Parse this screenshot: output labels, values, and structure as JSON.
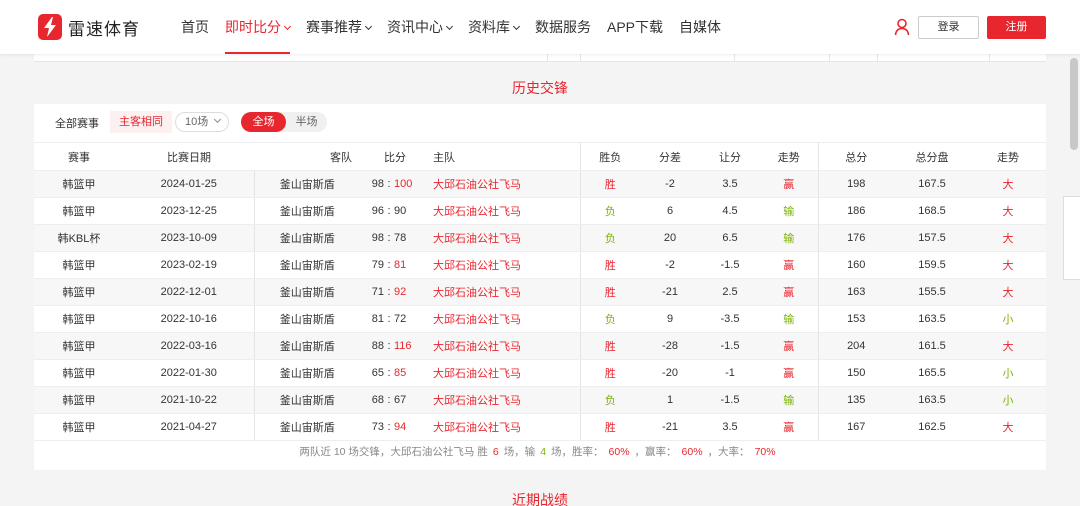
{
  "brand": {
    "name": "雷速体育",
    "accent": "#e8262e"
  },
  "nav": [
    {
      "label": "首页",
      "dropdown": false,
      "active": false
    },
    {
      "label": "即时比分",
      "dropdown": true,
      "active": true
    },
    {
      "label": "赛事推荐",
      "dropdown": true,
      "active": false
    },
    {
      "label": "资讯中心",
      "dropdown": true,
      "active": false
    },
    {
      "label": "资料库",
      "dropdown": true,
      "active": false
    },
    {
      "label": "数据服务",
      "dropdown": false,
      "active": false
    },
    {
      "label": "APP下载",
      "dropdown": false,
      "active": false
    },
    {
      "label": "自媒体",
      "dropdown": false,
      "active": false
    }
  ],
  "auth": {
    "login": "登录",
    "register": "注册"
  },
  "h2h": {
    "title": "历史交锋",
    "filters": {
      "all": "全部赛事",
      "same_home_away": "主客相同",
      "count": "10场",
      "full": "全场",
      "half": "半场"
    },
    "headers": [
      "赛事",
      "比赛日期",
      "客队",
      "比分",
      "主队",
      "胜负",
      "分差",
      "让分",
      "走势",
      "总分",
      "总分盘",
      "走势"
    ],
    "rows": [
      {
        "league": "韩篮甲",
        "date": "2024-01-25",
        "away": "釜山宙斯盾",
        "away_score": "98",
        "home_score": "100",
        "home": "大邱石油公社飞马",
        "result": "胜",
        "diff": "-2",
        "handicap": "3.5",
        "trend": "赢",
        "total": "198",
        "total_line": "167.5",
        "ou": "大"
      },
      {
        "league": "韩篮甲",
        "date": "2023-12-25",
        "away": "釜山宙斯盾",
        "away_score": "96",
        "home_score": "90",
        "home": "大邱石油公社飞马",
        "result": "负",
        "diff": "6",
        "handicap": "4.5",
        "trend": "输",
        "total": "186",
        "total_line": "168.5",
        "ou": "大"
      },
      {
        "league": "韩KBL杯",
        "date": "2023-10-09",
        "away": "釜山宙斯盾",
        "away_score": "98",
        "home_score": "78",
        "home": "大邱石油公社飞马",
        "result": "负",
        "diff": "20",
        "handicap": "6.5",
        "trend": "输",
        "total": "176",
        "total_line": "157.5",
        "ou": "大"
      },
      {
        "league": "韩篮甲",
        "date": "2023-02-19",
        "away": "釜山宙斯盾",
        "away_score": "79",
        "home_score": "81",
        "home": "大邱石油公社飞马",
        "result": "胜",
        "diff": "-2",
        "handicap": "-1.5",
        "trend": "赢",
        "total": "160",
        "total_line": "159.5",
        "ou": "大"
      },
      {
        "league": "韩篮甲",
        "date": "2022-12-01",
        "away": "釜山宙斯盾",
        "away_score": "71",
        "home_score": "92",
        "home": "大邱石油公社飞马",
        "result": "胜",
        "diff": "-21",
        "handicap": "2.5",
        "trend": "赢",
        "total": "163",
        "total_line": "155.5",
        "ou": "大"
      },
      {
        "league": "韩篮甲",
        "date": "2022-10-16",
        "away": "釜山宙斯盾",
        "away_score": "81",
        "home_score": "72",
        "home": "大邱石油公社飞马",
        "result": "负",
        "diff": "9",
        "handicap": "-3.5",
        "trend": "输",
        "total": "153",
        "total_line": "163.5",
        "ou": "小"
      },
      {
        "league": "韩篮甲",
        "date": "2022-03-16",
        "away": "釜山宙斯盾",
        "away_score": "88",
        "home_score": "116",
        "home": "大邱石油公社飞马",
        "result": "胜",
        "diff": "-28",
        "handicap": "-1.5",
        "trend": "赢",
        "total": "204",
        "total_line": "161.5",
        "ou": "大"
      },
      {
        "league": "韩篮甲",
        "date": "2022-01-30",
        "away": "釜山宙斯盾",
        "away_score": "65",
        "home_score": "85",
        "home": "大邱石油公社飞马",
        "result": "胜",
        "diff": "-20",
        "handicap": "-1",
        "trend": "赢",
        "total": "150",
        "total_line": "165.5",
        "ou": "小"
      },
      {
        "league": "韩篮甲",
        "date": "2021-10-22",
        "away": "釜山宙斯盾",
        "away_score": "68",
        "home_score": "67",
        "home": "大邱石油公社飞马",
        "result": "负",
        "diff": "1",
        "handicap": "-1.5",
        "trend": "输",
        "total": "135",
        "total_line": "163.5",
        "ou": "小"
      },
      {
        "league": "韩篮甲",
        "date": "2021-04-27",
        "away": "釜山宙斯盾",
        "away_score": "73",
        "home_score": "94",
        "home": "大邱石油公社飞马",
        "result": "胜",
        "diff": "-21",
        "handicap": "3.5",
        "trend": "赢",
        "total": "167",
        "total_line": "162.5",
        "ou": "大"
      }
    ],
    "summary": {
      "prefix": "两队近 10 场交锋，大邱石油公社飞马 胜",
      "wins": "6",
      "mid1": "场，输",
      "losses": "4",
      "mid2": "场，胜率：",
      "win_rate": "60%",
      "mid3": "，赢率：",
      "cover_rate": "60%",
      "mid4": "，大率：",
      "over_rate": "70%"
    }
  },
  "recent_title": "近期战绩"
}
